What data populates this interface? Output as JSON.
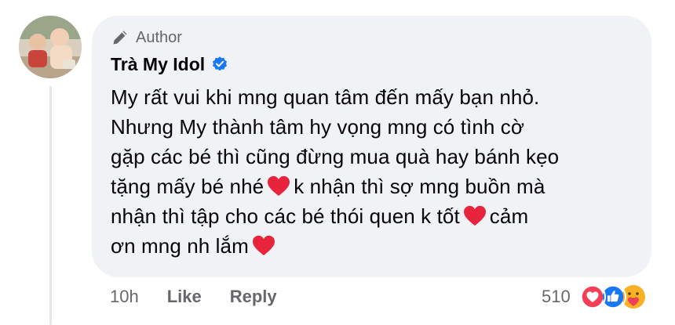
{
  "comment": {
    "author_badge": "Author",
    "author_name": "Trà My Idol",
    "lines": [
      "My rất vui khi mng quan tâm đến mấy bạn nhỏ.",
      "Nhưng My thành tâm hy vọng mng có tình cờ",
      "gặp các bé thì cũng đừng mua quà hay bánh kẹo",
      "tặng mấy bé nhé",
      "k nhận thì sợ mng buồn mà",
      "nhận thì tập cho các bé thói quen k tốt",
      "cảm",
      "ơn mng nh lắm"
    ],
    "time": "10h",
    "like_label": "Like",
    "reply_label": "Reply",
    "reaction_count": "510",
    "reactions": [
      "love-reaction-icon",
      "like-reaction-icon",
      "care-reaction-icon"
    ]
  },
  "colors": {
    "bubble": "#f0f2f5",
    "meta_text": "#65676b",
    "verified": "#1877f2",
    "heart": "#e8243c"
  }
}
